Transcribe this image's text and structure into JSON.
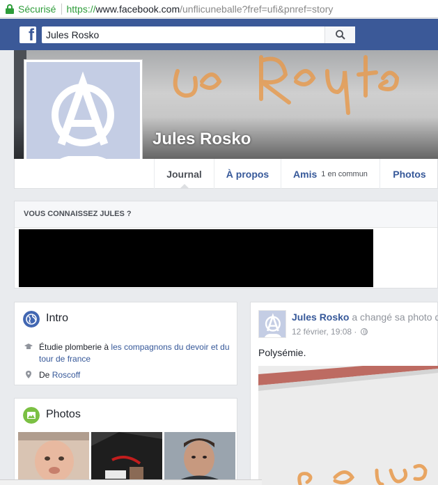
{
  "browser": {
    "secure_label": "Sécurisé",
    "url_protocol": "https://",
    "url_host": "www.facebook.com",
    "url_path": "/unflicuneballe?fref=ufi&pnref=story"
  },
  "topbar": {
    "logo": "f",
    "search_value": "Jules Rosko"
  },
  "profile": {
    "name": "Jules Rosko"
  },
  "tabs": [
    {
      "label": "Journal",
      "sub": ""
    },
    {
      "label": "À propos",
      "sub": ""
    },
    {
      "label": "Amis",
      "sub": "1 en commun"
    },
    {
      "label": "Photos",
      "sub": ""
    }
  ],
  "know_card": {
    "title": "VOUS CONNAISSEZ JULES ?"
  },
  "intro": {
    "title": "Intro",
    "study_prefix": "Étudie plomberie à ",
    "study_link": "les compagnons du devoir et du tour de france",
    "from_prefix": "De ",
    "from_link": "Roscoff"
  },
  "photos_card": {
    "title": "Photos"
  },
  "post": {
    "author": "Jules Rosko",
    "action": " a changé sa photo de profil",
    "date": "12 février, 19:08 ·",
    "text": "Polysémie."
  },
  "colors": {
    "facebook_blue": "#3b5998",
    "link": "#365899",
    "secure_green": "#2e9d3a"
  }
}
